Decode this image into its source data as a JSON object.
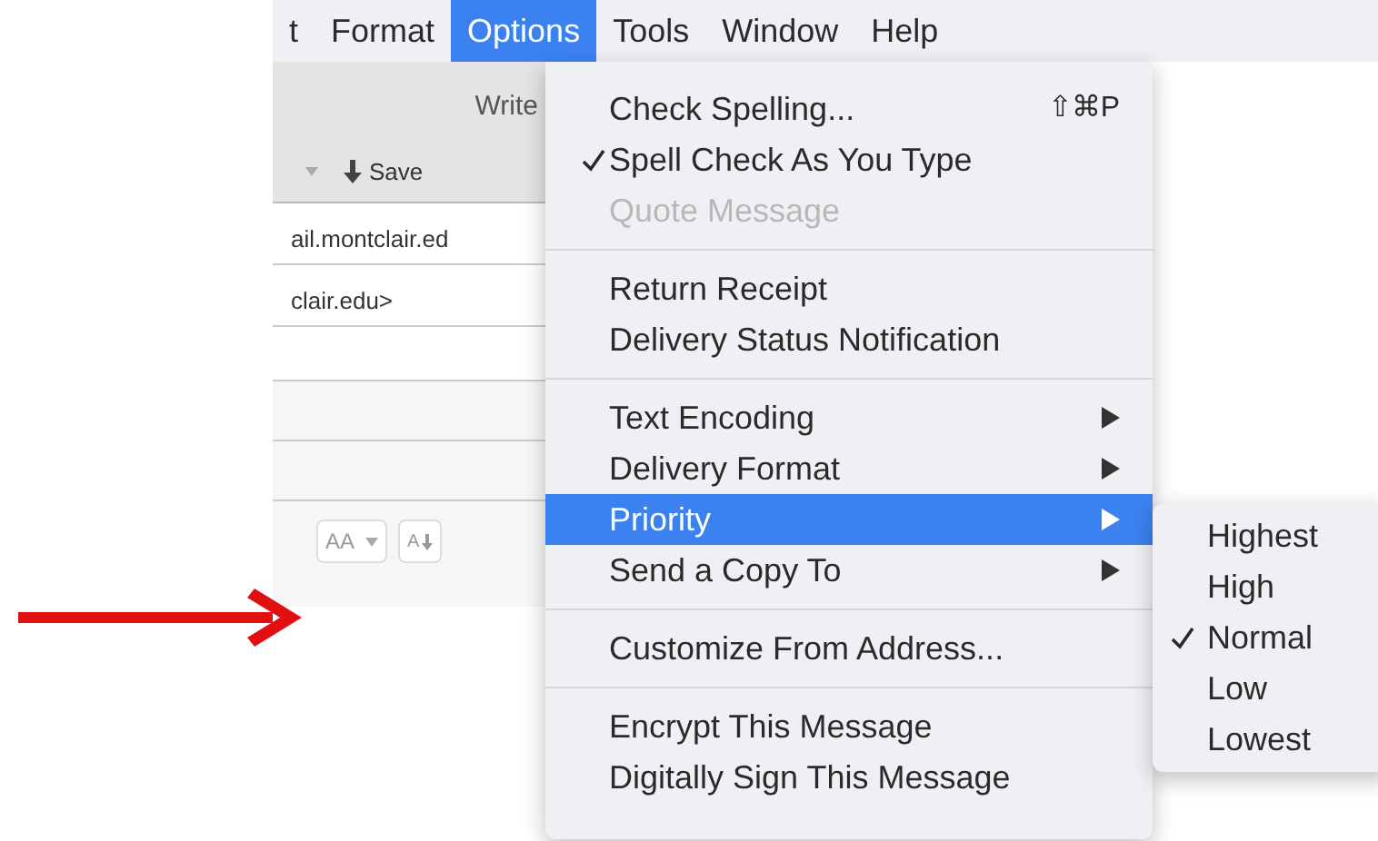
{
  "menu_bar": {
    "items": [
      {
        "label": "t",
        "selected": false
      },
      {
        "label": "Format",
        "selected": false
      },
      {
        "label": "Options",
        "selected": true
      },
      {
        "label": "Tools",
        "selected": false
      },
      {
        "label": "Window",
        "selected": false
      },
      {
        "label": "Help",
        "selected": false
      }
    ]
  },
  "compose_window": {
    "title": "Write",
    "save_button": {
      "label": "Save"
    },
    "header_fields": [
      "ail.montclair.ed",
      "clair.edu>"
    ],
    "format_toolbar": {
      "font_size_button": {
        "label": "AA"
      },
      "smaller_button": {
        "label": "A"
      }
    }
  },
  "options_menu": {
    "sections": [
      [
        {
          "label": "Check Spelling...",
          "shortcut": "⇧⌘P",
          "checked": false,
          "disabled": false,
          "has_submenu": false,
          "selected": false
        },
        {
          "label": "Spell Check As You Type",
          "checked": true,
          "disabled": false,
          "has_submenu": false,
          "selected": false
        },
        {
          "label": "Quote Message",
          "checked": false,
          "disabled": true,
          "has_submenu": false,
          "selected": false
        }
      ],
      [
        {
          "label": "Return Receipt",
          "checked": false,
          "disabled": false,
          "has_submenu": false,
          "selected": false
        },
        {
          "label": "Delivery Status Notification",
          "checked": false,
          "disabled": false,
          "has_submenu": false,
          "selected": false
        }
      ],
      [
        {
          "label": "Text Encoding",
          "checked": false,
          "disabled": false,
          "has_submenu": true,
          "selected": false
        },
        {
          "label": "Delivery Format",
          "checked": false,
          "disabled": false,
          "has_submenu": true,
          "selected": false
        },
        {
          "label": "Priority",
          "checked": false,
          "disabled": false,
          "has_submenu": true,
          "selected": true
        },
        {
          "label": "Send a Copy To",
          "checked": false,
          "disabled": false,
          "has_submenu": true,
          "selected": false
        }
      ],
      [
        {
          "label": "Customize From Address...",
          "checked": false,
          "disabled": false,
          "has_submenu": false,
          "selected": false
        }
      ],
      [
        {
          "label": "Encrypt This Message",
          "checked": false,
          "disabled": false,
          "has_submenu": false,
          "selected": false
        },
        {
          "label": "Digitally Sign This Message",
          "checked": false,
          "disabled": false,
          "has_submenu": false,
          "selected": false
        }
      ]
    ]
  },
  "priority_submenu": {
    "items": [
      {
        "label": "Highest",
        "checked": false
      },
      {
        "label": "High",
        "checked": false
      },
      {
        "label": "Normal",
        "checked": true
      },
      {
        "label": "Low",
        "checked": false
      },
      {
        "label": "Lowest",
        "checked": false
      }
    ]
  }
}
